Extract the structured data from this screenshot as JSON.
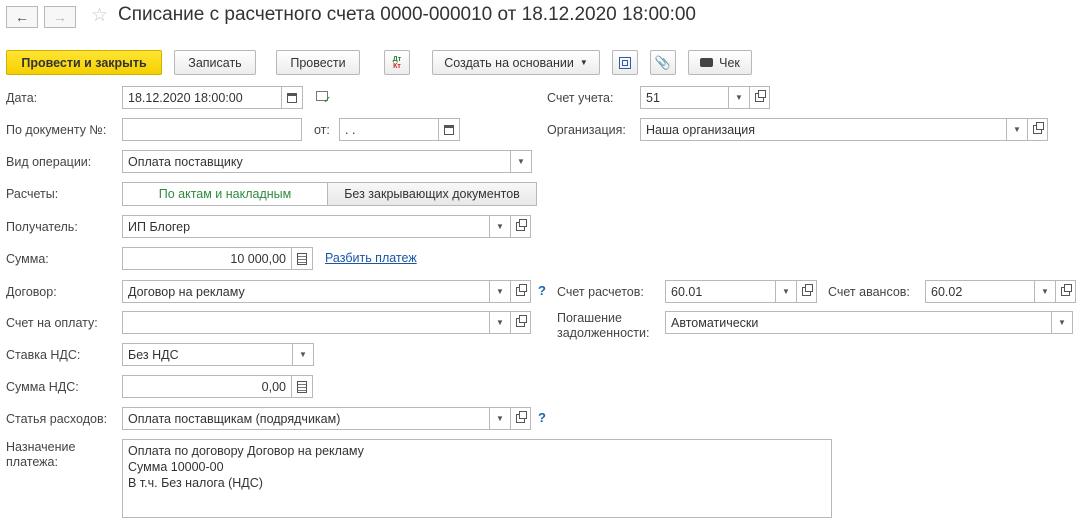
{
  "window": {
    "title": "Списание с расчетного счета 0000-000010 от 18.12.2020 18:00:00",
    "back_icon": "arrow-left-icon",
    "forward_icon": "arrow-right-icon",
    "favorite_icon": "star-icon"
  },
  "toolbar": {
    "post_close_label": "Провести и закрыть",
    "save_label": "Записать",
    "post_label": "Провести",
    "dtkt_top": "Дт",
    "dtkt_bottom": "Кт",
    "create_based_label": "Создать на основании",
    "receipt_label": "Чек"
  },
  "form": {
    "date": {
      "label": "Дата:",
      "value": "18.12.2020 18:00:00"
    },
    "account": {
      "label": "Счет учета:",
      "value": "51"
    },
    "doc_number": {
      "label": "По документу №:",
      "value": "",
      "from_label": "от:",
      "from_value": " .  ."
    },
    "organization": {
      "label": "Организация:",
      "value": "Наша организация"
    },
    "operation_type": {
      "label": "Вид операции:",
      "value": "Оплата поставщику"
    },
    "settlements": {
      "label": "Расчеты:",
      "option1": "По актам и накладным",
      "option2": "Без закрывающих документов",
      "selected": "По актам и накладным"
    },
    "recipient": {
      "label": "Получатель:",
      "value": "ИП Блогер"
    },
    "amount": {
      "label": "Сумма:",
      "value": "10 000,00",
      "split_link": "Разбить платеж"
    },
    "contract": {
      "label": "Договор:",
      "value": "Договор на рекламу",
      "help": "?"
    },
    "settlement_account": {
      "label": "Счет расчетов:",
      "value": "60.01"
    },
    "advance_account": {
      "label": "Счет авансов:",
      "value": "60.02"
    },
    "invoice": {
      "label": "Счет на оплату:",
      "value": ""
    },
    "debt_repayment": {
      "label_line1": "Погашение",
      "label_line2": "задолженности:",
      "value": "Автоматически"
    },
    "vat_rate": {
      "label": "Ставка НДС:",
      "value": "Без НДС"
    },
    "vat_amount": {
      "label": "Сумма НДС:",
      "value": "0,00"
    },
    "expense_item": {
      "label": "Статья расходов:",
      "value": "Оплата поставщикам (подрядчикам)",
      "help": "?"
    },
    "purpose": {
      "label_line1": "Назначение",
      "label_line2": "платежа:",
      "lines": [
        "Оплата по договору Договор на рекламу",
        "Сумма 10000-00",
        "В т.ч. Без налога (НДС)"
      ]
    }
  },
  "colors": {
    "primary_button": "#f5cf00",
    "link": "#1a56a8",
    "toggle_selected_text": "#2e8b3d",
    "help": "#1a66b3"
  }
}
